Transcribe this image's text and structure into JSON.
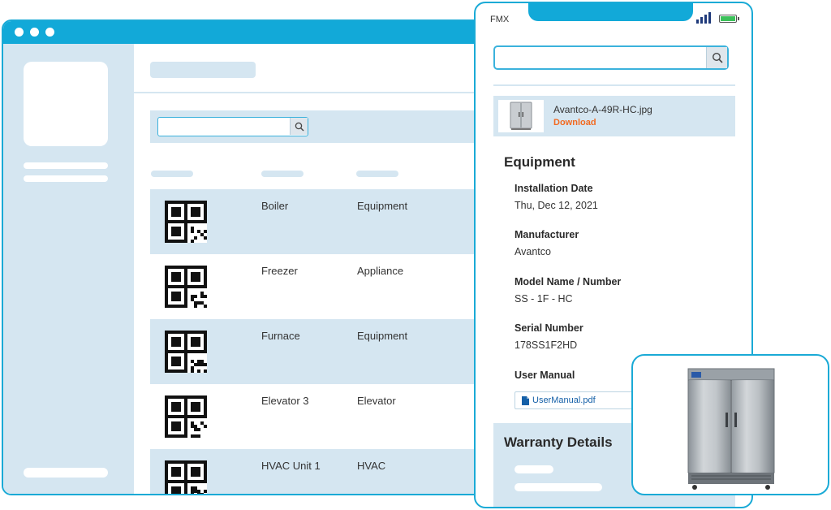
{
  "desktop": {
    "rows": [
      {
        "name": "Boiler",
        "type": "Equipment"
      },
      {
        "name": "Freezer",
        "type": "Appliance"
      },
      {
        "name": "Furnace",
        "type": "Equipment"
      },
      {
        "name": "Elevator 3",
        "type": "Elevator"
      },
      {
        "name": "HVAC Unit 1",
        "type": "HVAC"
      }
    ]
  },
  "phone": {
    "carrier": "FMX",
    "attachment": {
      "filename": "Avantco-A-49R-HC.jpg",
      "download_label": "Download"
    },
    "section_title": "Equipment",
    "fields": {
      "install_label": "Installation Date",
      "install_value": "Thu, Dec 12, 2021",
      "manufacturer_label": "Manufacturer",
      "manufacturer_value": "Avantco",
      "model_label": "Model Name / Number",
      "model_value": "SS - 1F - HC",
      "serial_label": "Serial Number",
      "serial_value": "178SS1F2HD",
      "manual_label": "User Manual",
      "manual_file": "UserManual.pdf"
    },
    "warranty_title": "Warranty Details"
  },
  "colors": {
    "accent": "#12a9d8",
    "panel": "#d5e6f1",
    "download": "#f26a21",
    "link": "#1560a8"
  },
  "icons": [
    "search-icon",
    "signal-icon",
    "battery-icon",
    "pdf-file-icon",
    "refrigerator-image"
  ]
}
